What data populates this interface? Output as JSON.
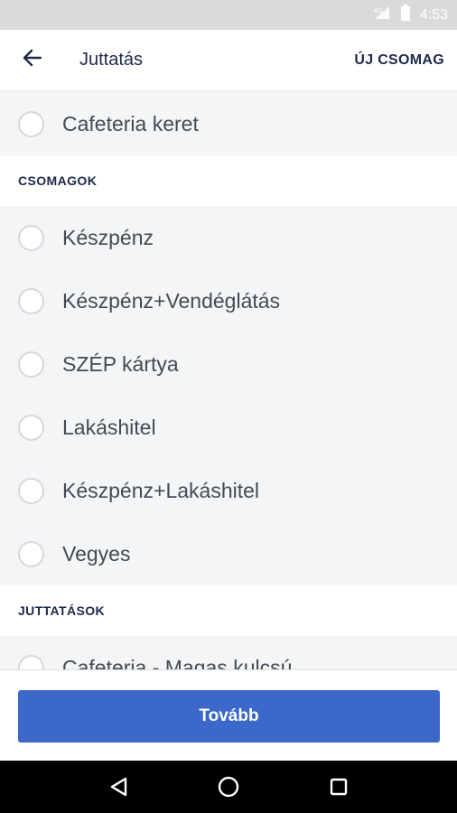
{
  "status_bar": {
    "time": "4:53"
  },
  "app_bar": {
    "title": "Juttatás",
    "action_label": "ÚJ CSOMAG"
  },
  "top_option": {
    "label": "Cafeteria keret"
  },
  "sections": [
    {
      "title": "CSOMAGOK",
      "items": [
        "Készpénz",
        "Készpénz+Vendéglátás",
        "SZÉP kártya",
        "Lakáshitel",
        "Készpénz+Lakáshitel",
        "Vegyes"
      ]
    },
    {
      "title": "JUTTATÁSOK",
      "items": [
        "Cafeteria - Magas kulcsú"
      ]
    }
  ],
  "footer": {
    "button_label": "Tovább"
  },
  "colors": {
    "accent": "#3b68c9",
    "title": "#1e2a4a",
    "background": "#f4f5f7"
  },
  "icons": {
    "back": "arrow-left-icon",
    "radio": "radio-unchecked-icon",
    "signal": "signal-icon",
    "battery": "battery-icon",
    "nav": [
      "back-triangle-icon",
      "home-circle-icon",
      "recents-square-icon"
    ]
  }
}
